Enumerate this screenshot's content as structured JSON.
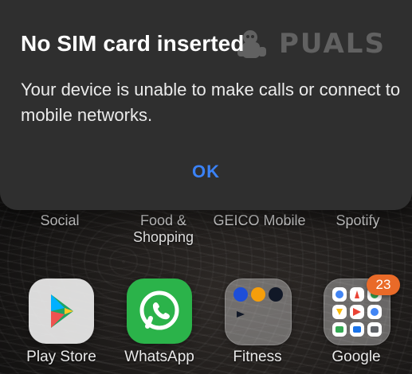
{
  "dialog": {
    "title": "No SIM card inserted",
    "message": "Your device is unable to make calls or connect to mobile networks.",
    "ok_label": "OK",
    "accent_color": "#3b82f6",
    "background_color": "#2f2f2f"
  },
  "home": {
    "row_labels": [
      {
        "label": "Social"
      },
      {
        "label": "Food &\nShopping"
      },
      {
        "label": "GEICO Mobile"
      },
      {
        "label": "Spotify"
      }
    ],
    "dock": [
      {
        "label": "Play Store",
        "icon": "play-store-icon"
      },
      {
        "label": "WhatsApp",
        "icon": "whatsapp-icon"
      },
      {
        "label": "Fitness",
        "icon": "folder-icon"
      },
      {
        "label": "Google",
        "icon": "folder-icon",
        "badge": "23",
        "badge_color": "#e96a28"
      }
    ]
  },
  "watermark": {
    "text": "PUALS"
  }
}
